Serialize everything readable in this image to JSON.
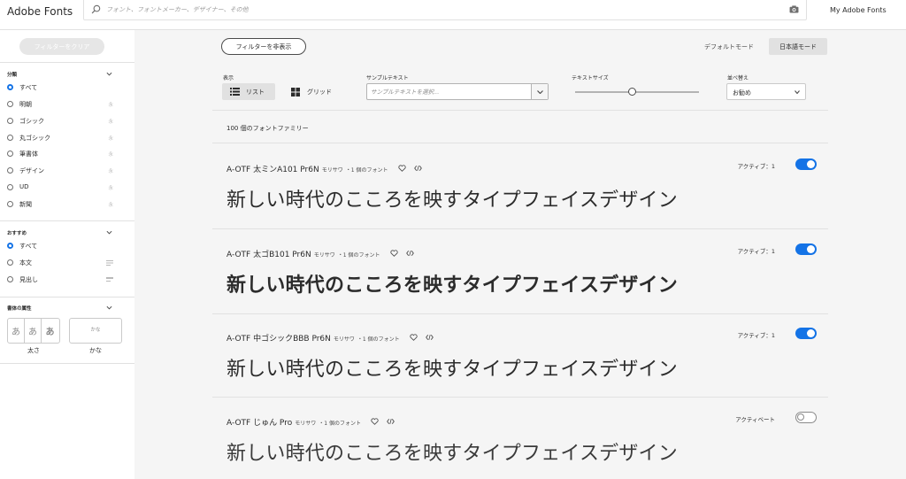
{
  "header": {
    "logo": "Adobe Fonts",
    "search_placeholder": "フォント、フォントメーカー、デザイナー、その他",
    "my_fonts": "My Adobe Fonts"
  },
  "sidebar": {
    "clear_filters": "フィルターをクリア",
    "classification": {
      "title": "分類",
      "items": [
        {
          "label": "すべて",
          "glyph": "",
          "selected": true
        },
        {
          "label": "明朝",
          "glyph": "永",
          "selected": false
        },
        {
          "label": "ゴシック",
          "glyph": "永",
          "selected": false
        },
        {
          "label": "丸ゴシック",
          "glyph": "永",
          "selected": false
        },
        {
          "label": "筆書体",
          "glyph": "永",
          "selected": false
        },
        {
          "label": "デザイン",
          "glyph": "永",
          "selected": false
        },
        {
          "label": "UD",
          "glyph": "永",
          "selected": false
        },
        {
          "label": "新聞",
          "glyph": "永",
          "selected": false
        }
      ]
    },
    "recommended": {
      "title": "おすすめ",
      "items": [
        {
          "label": "すべて",
          "selected": true
        },
        {
          "label": "本文",
          "selected": false
        },
        {
          "label": "見出し",
          "selected": false
        }
      ]
    },
    "properties": {
      "title": "書体の属性",
      "weight_glyphs": [
        "あ",
        "あ",
        "あ"
      ],
      "weight_label": "太さ",
      "kana_glyph": "かな",
      "kana_label": "かな"
    }
  },
  "toolbar": {
    "hide_filters": "フィルターを非表示",
    "mode_default": "デフォルトモード",
    "mode_japanese": "日本語モード",
    "view_label": "表示",
    "view_list": "リスト",
    "view_grid": "グリッド",
    "sample_label": "サンプルテキスト",
    "sample_placeholder": "サンプルテキストを選択...",
    "text_size_label": "テキストサイズ",
    "text_size_level": 0.46,
    "sort_label": "並べ替え",
    "sort_value": "お勧め"
  },
  "results": {
    "count": "100 個のフォントファミリー",
    "fonts": [
      {
        "name": "A-OTF 太ミンA101 Pr6N",
        "foundry": "モリサワ",
        "count": "・1 個のフォント",
        "status": "アクティブ：1",
        "active": true,
        "sample": "新しい時代のこころを映すタイプフェイスデザイン"
      },
      {
        "name": "A-OTF 太ゴB101 Pr6N",
        "foundry": "モリサワ",
        "count": "・1 個のフォント",
        "status": "アクティブ：1",
        "active": true,
        "sample": "新しい時代のこころを映すタイプフェイスデザイン"
      },
      {
        "name": "A-OTF 中ゴシックBBB Pr6N",
        "foundry": "モリサワ",
        "count": "・1 個のフォント",
        "status": "アクティブ：1",
        "active": true,
        "sample": "新しい時代のこころを映すタイプフェイスデザイン"
      },
      {
        "name": "A-OTF じゅん Pro",
        "foundry": "モリサワ",
        "count": "・1 個のフォント",
        "status": "アクティベート",
        "active": false,
        "sample": "新しい時代のこころを映すタイプフェイスデザイン"
      }
    ]
  },
  "colors": {
    "accent": "#1473e6",
    "page_bg": "#f5f5f5",
    "text": "#2c2c2c"
  },
  "icons": [
    "search-icon",
    "camera-icon",
    "chevron-down-icon",
    "list-view-icon",
    "grid-view-icon",
    "heart-icon",
    "code-icon"
  ]
}
